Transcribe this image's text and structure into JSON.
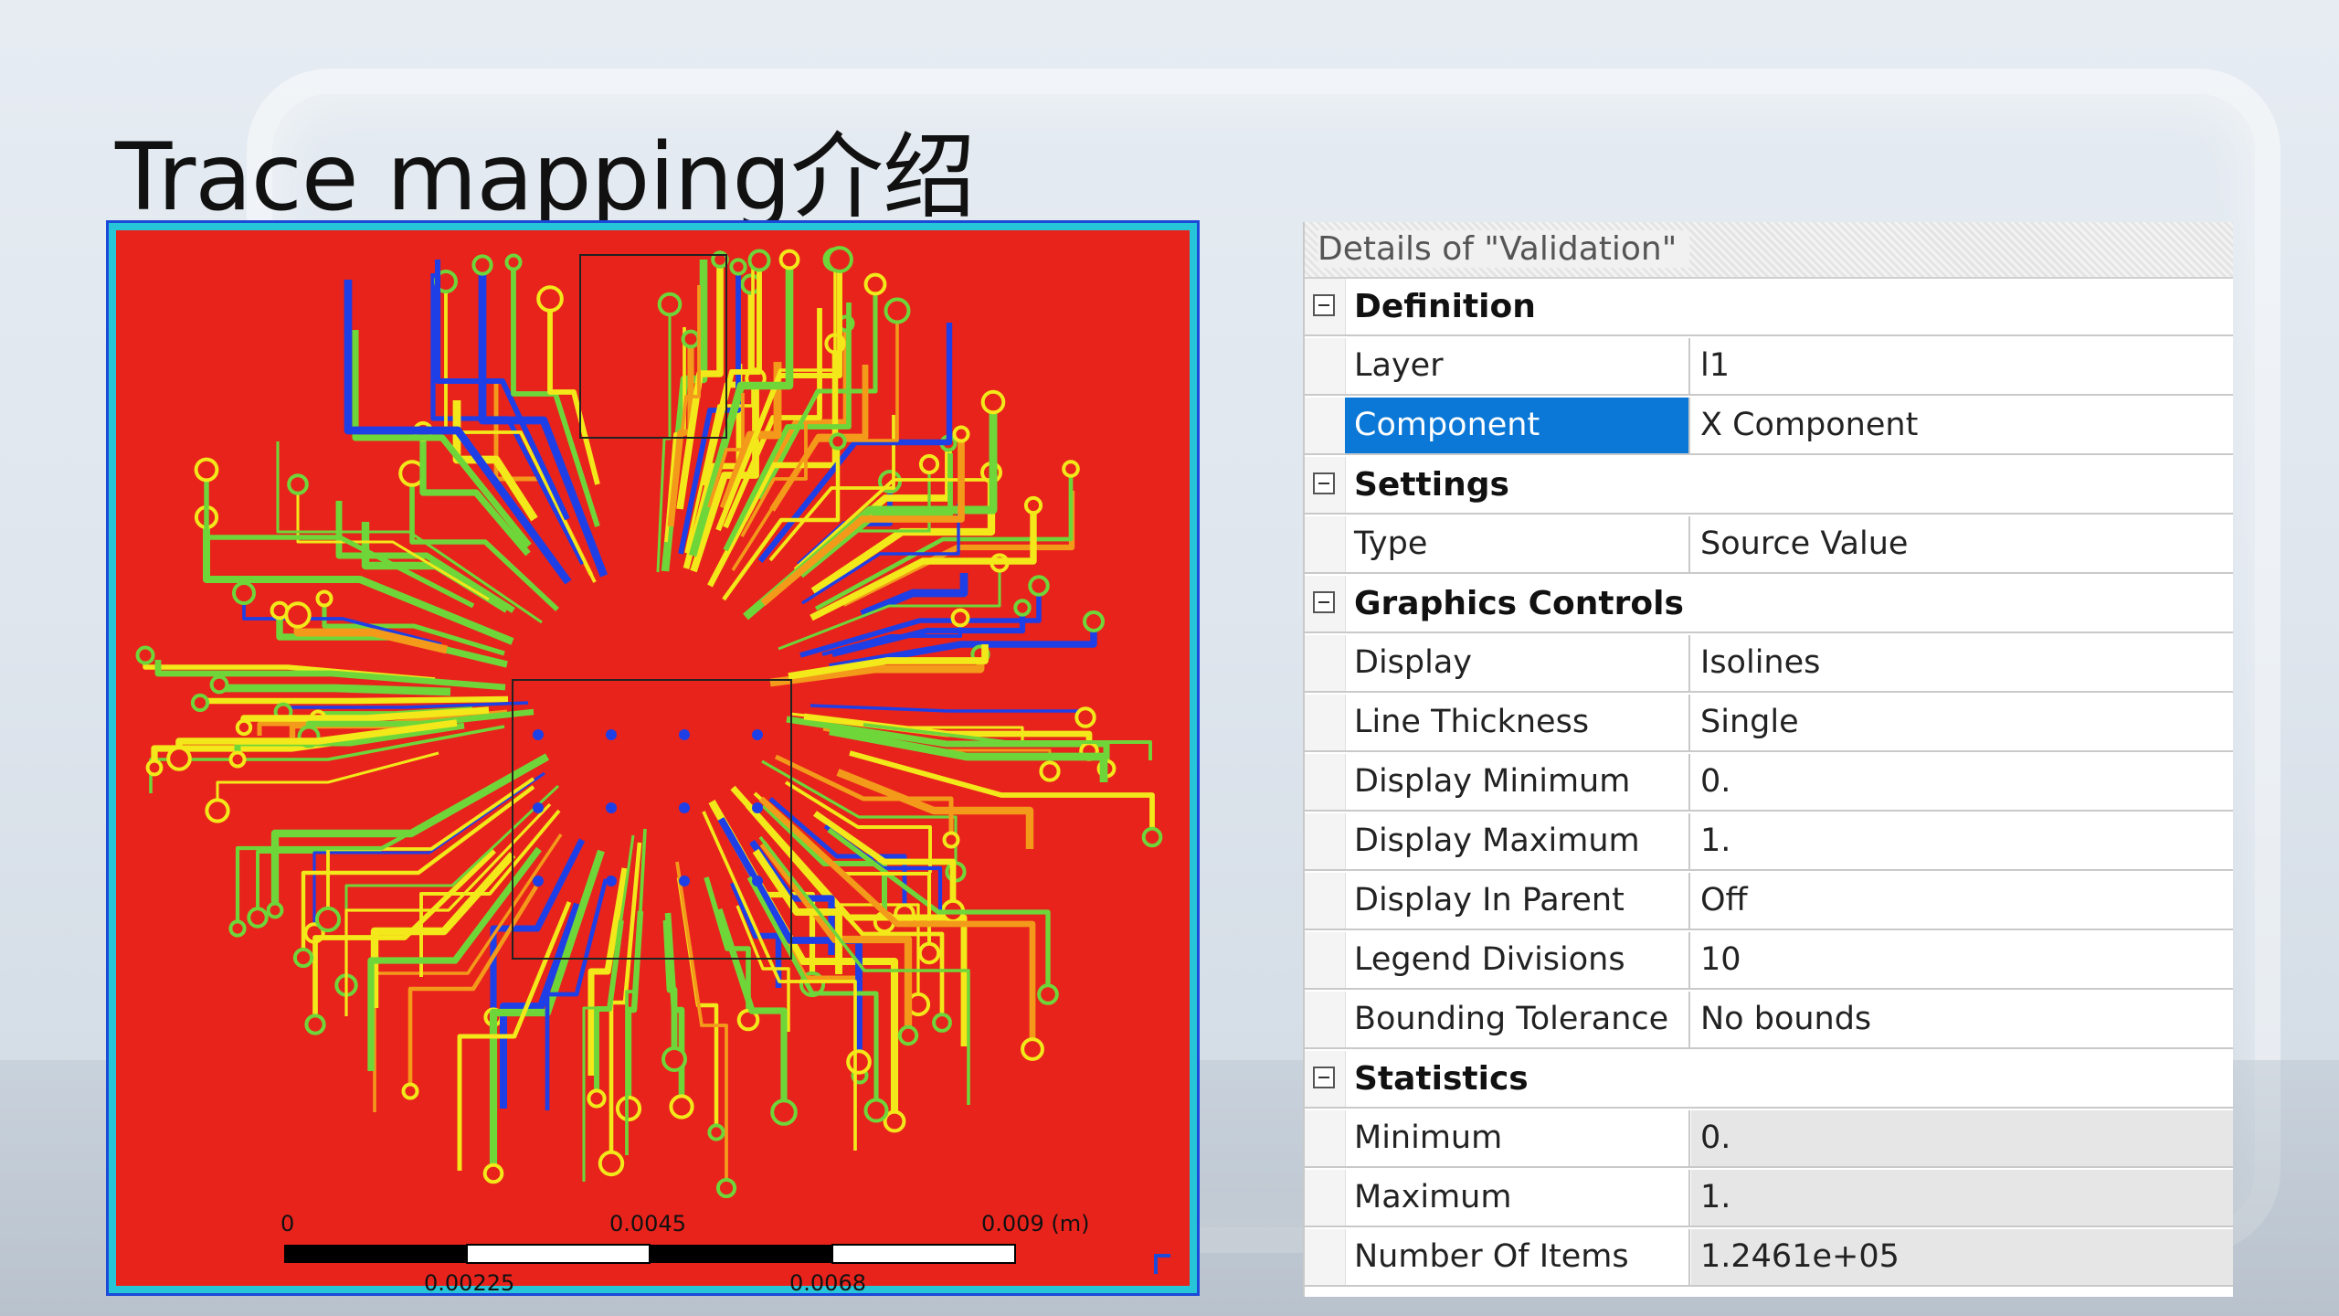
{
  "slide": {
    "title": "Trace mapping介绍"
  },
  "scale_bar": {
    "top_labels": [
      "0",
      "0.0045",
      "0.009 (m)"
    ],
    "bottom_labels": [
      "0.00225",
      "0.0068"
    ]
  },
  "details": {
    "header": "Details of \"Validation\"",
    "groups": [
      {
        "label": "Definition",
        "props": [
          {
            "name": "Layer",
            "value": "l1"
          },
          {
            "name": "Component",
            "value": "X Component",
            "selected": true
          }
        ]
      },
      {
        "label": "Settings",
        "props": [
          {
            "name": "Type",
            "value": "Source Value"
          }
        ]
      },
      {
        "label": "Graphics Controls",
        "props": [
          {
            "name": "Display",
            "value": "Isolines"
          },
          {
            "name": "Line Thickness",
            "value": "Single"
          },
          {
            "name": "Display Minimum",
            "value": "0."
          },
          {
            "name": "Display Maximum",
            "value": "1."
          },
          {
            "name": "Display In Parent",
            "value": "Off"
          },
          {
            "name": "Legend Divisions",
            "value": "10"
          },
          {
            "name": "Bounding Tolerance",
            "value": "No bounds"
          }
        ]
      },
      {
        "label": "Statistics",
        "props": [
          {
            "name": "Minimum",
            "value": "0.",
            "readonly": true
          },
          {
            "name": "Maximum",
            "value": "1.",
            "readonly": true
          },
          {
            "name": "Number Of Items",
            "value": "1.2461e+05",
            "readonly": true
          }
        ]
      }
    ]
  },
  "colors": {
    "board": "#e8231c",
    "trace_yellow": "#f2e81a",
    "trace_green": "#6fd63a",
    "trace_blue": "#1e3fe6",
    "trace_orange": "#f39a1a",
    "selection": "#0b78d7"
  }
}
